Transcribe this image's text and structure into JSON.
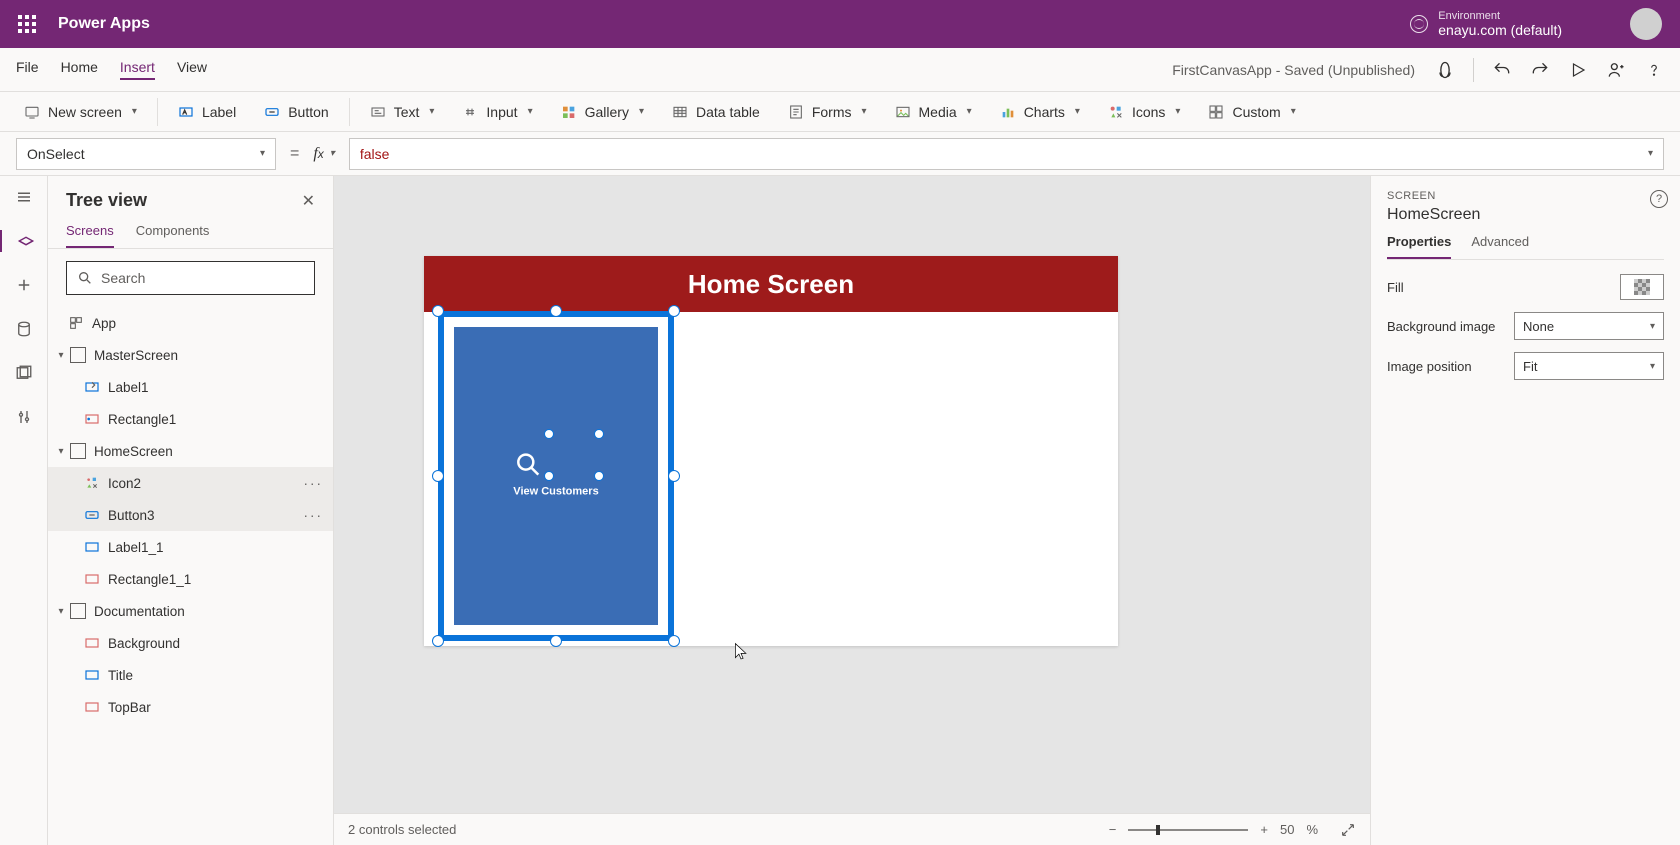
{
  "header": {
    "app_name": "Power Apps",
    "env_label": "Environment",
    "env_value": "enayu.com (default)"
  },
  "menu": {
    "tabs": [
      "File",
      "Home",
      "Insert",
      "View"
    ],
    "active": "Insert",
    "doc_title": "FirstCanvasApp - Saved (Unpublished)"
  },
  "ribbon": {
    "new_screen": "New screen",
    "label": "Label",
    "button": "Button",
    "text": "Text",
    "input": "Input",
    "gallery": "Gallery",
    "data_table": "Data table",
    "forms": "Forms",
    "media": "Media",
    "charts": "Charts",
    "icons": "Icons",
    "custom": "Custom"
  },
  "formula": {
    "property": "OnSelect",
    "value": "false"
  },
  "treeview": {
    "title": "Tree view",
    "tabs": [
      "Screens",
      "Components"
    ],
    "active": "Screens",
    "search_ph": "Search",
    "nodes": {
      "app": "App",
      "s1": "MasterScreen",
      "s1c1": "Label1",
      "s1c2": "Rectangle1",
      "s2": "HomeScreen",
      "s2c1": "Icon2",
      "s2c2": "Button3",
      "s2c3": "Label1_1",
      "s2c4": "Rectangle1_1",
      "s3": "Documentation",
      "s3c1": "Background",
      "s3c2": "Title",
      "s3c3": "TopBar"
    }
  },
  "canvas": {
    "screen_title": "Home Screen",
    "button_label": "View Customers"
  },
  "status": {
    "selection": "2 controls selected",
    "zoom": "50",
    "pct": "%"
  },
  "rpane": {
    "cat": "SCREEN",
    "name": "HomeScreen",
    "tabs": [
      "Properties",
      "Advanced"
    ],
    "active": "Properties",
    "fill": "Fill",
    "bg_img": "Background image",
    "bg_img_val": "None",
    "img_pos": "Image position",
    "img_pos_val": "Fit"
  }
}
